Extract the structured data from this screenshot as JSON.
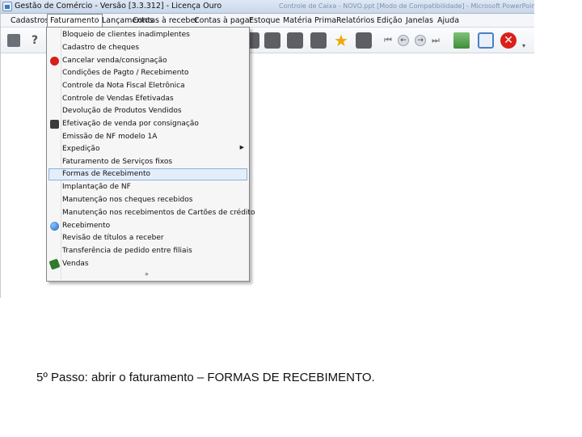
{
  "window": {
    "title": "Gestão de Comércio - Versão [3.3.312] - Licença Ouro",
    "right_title": "Controle de Caixa - NOVO.ppt [Modo de Compatibilidade] - Microsoft PowerPoint"
  },
  "menubar": {
    "items": [
      "Cadastros",
      "Faturamento",
      "Lançamentos",
      "Contas à receber",
      "Contas à pagar",
      "Estoque",
      "Matéria Prima",
      "Relatórios",
      "Edição",
      "Janelas",
      "Ajuda"
    ],
    "active": "Faturamento"
  },
  "toolbar": {
    "icons": [
      "cart-icon",
      "help-icon",
      "document-icon",
      "pages-icon",
      "stamp-icon",
      "edit-icon",
      "favorite-star-icon",
      "refresh-icon",
      "first-icon",
      "previous-icon",
      "next-icon",
      "last-icon",
      "chart-icon",
      "search-icon",
      "exit-icon"
    ]
  },
  "dropdown": {
    "items": [
      {
        "label": "Bloqueio de clientes inadimplentes",
        "icon": ""
      },
      {
        "label": "Cadastro de cheques",
        "icon": ""
      },
      {
        "label": "Cancelar venda/consignação",
        "icon": "cancel-icon"
      },
      {
        "label": "Condições de Pagto / Recebimento",
        "icon": ""
      },
      {
        "label": "Controle da Nota Fiscal Eletrônica",
        "icon": ""
      },
      {
        "label": "Controle de Vendas Efetivadas",
        "icon": ""
      },
      {
        "label": "Devolução de Produtos Vendidos",
        "icon": ""
      },
      {
        "label": "Efetivação de venda por consignação",
        "icon": "person-icon"
      },
      {
        "label": "Emissão de NF modelo 1A",
        "icon": ""
      },
      {
        "label": "Expedição",
        "icon": "",
        "submenu": true
      },
      {
        "label": "Faturamento de Serviços fixos",
        "icon": ""
      },
      {
        "label": "Formas de Recebimento",
        "icon": "",
        "highlighted": true
      },
      {
        "label": "Implantação de NF",
        "icon": ""
      },
      {
        "label": "Manutenção nos cheques recebidos",
        "icon": ""
      },
      {
        "label": "Manutenção nos recebimentos de Cartões de crédito",
        "icon": ""
      },
      {
        "label": "Recebimento",
        "icon": "globe-icon"
      },
      {
        "label": "Revisão de títulos a receber",
        "icon": ""
      },
      {
        "label": "Transferência de pedido entre filiais",
        "icon": ""
      },
      {
        "label": "Vendas",
        "icon": "money-icon"
      }
    ],
    "more_indicator": "»"
  },
  "caption": "5º Passo: abrir o faturamento – FORMAS DE RECEBIMENTO."
}
